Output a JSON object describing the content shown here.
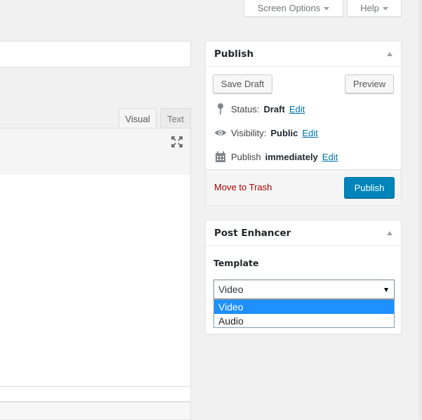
{
  "header": {
    "screen_options_label": "Screen Options",
    "help_label": "Help"
  },
  "editor": {
    "tabs": [
      {
        "label": "Visual",
        "active": true
      },
      {
        "label": "Text",
        "active": false
      }
    ]
  },
  "publish_box": {
    "title": "Publish",
    "save_draft_label": "Save Draft",
    "preview_label": "Preview",
    "status_label": "Status:",
    "status_value": "Draft",
    "visibility_label": "Visibility:",
    "visibility_value": "Public",
    "publish_label": "Publish",
    "publish_value": "immediately",
    "edit_label": "Edit",
    "trash_label": "Move to Trash",
    "publish_button_label": "Publish"
  },
  "post_enhancer": {
    "title": "Post Enhancer",
    "template_label": "Template",
    "selected_value": "Video",
    "options": [
      "Video",
      "Audio"
    ],
    "highlighted_option": "Video"
  },
  "colors": {
    "primary_button": "#0085ba",
    "link": "#0073aa",
    "trash_link": "#a00000",
    "highlight": "#1e90ff"
  }
}
